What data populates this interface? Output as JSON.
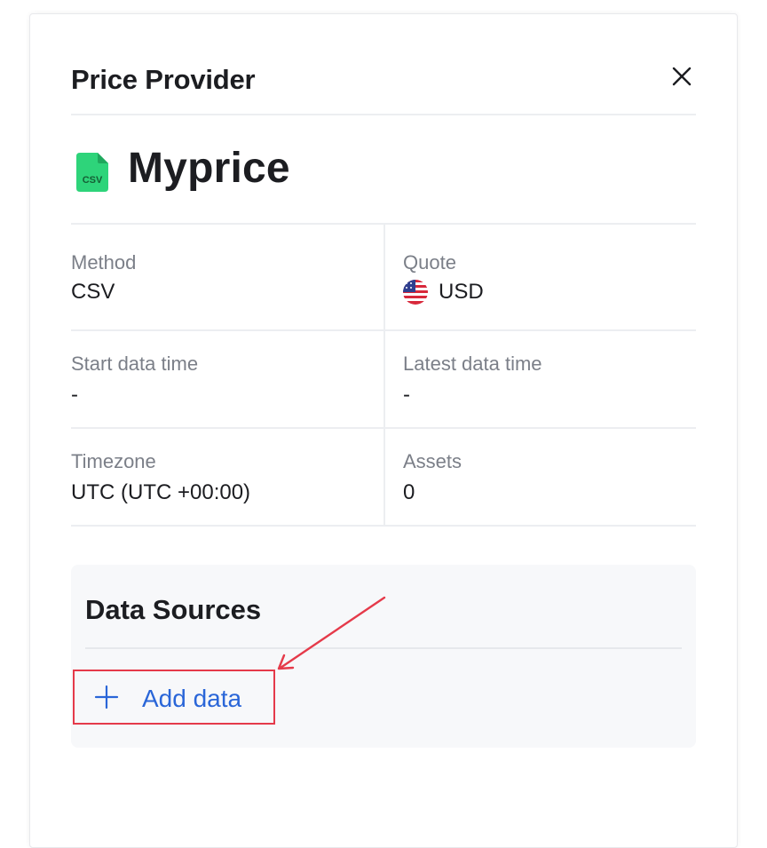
{
  "header": {
    "title": "Price Provider"
  },
  "provider": {
    "file_type": "CSV",
    "name": "Myprice"
  },
  "details": {
    "method": {
      "label": "Method",
      "value": "CSV"
    },
    "quote": {
      "label": "Quote",
      "value": "USD"
    },
    "start_time": {
      "label": "Start data time",
      "value": "-"
    },
    "latest_time": {
      "label": "Latest data time",
      "value": "-"
    },
    "timezone": {
      "label": "Timezone",
      "value": "UTC (UTC +00:00)"
    },
    "assets": {
      "label": "Assets",
      "value": "0"
    }
  },
  "data_sources": {
    "title": "Data Sources",
    "add_label": "Add data"
  },
  "colors": {
    "accent": "#2a66d8",
    "file_icon": "#2ed47a",
    "annotation": "#e53a4a"
  }
}
